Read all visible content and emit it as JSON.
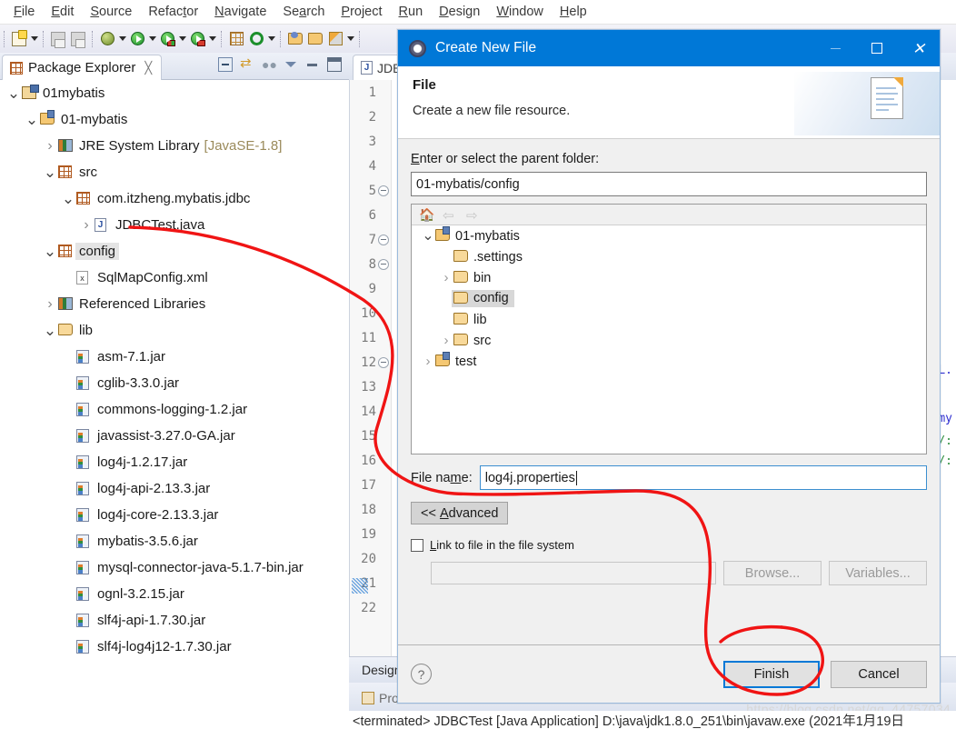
{
  "menubar": {
    "items": [
      {
        "label": "File",
        "mnemonic": "F"
      },
      {
        "label": "Edit",
        "mnemonic": "E"
      },
      {
        "label": "Source",
        "mnemonic": "S"
      },
      {
        "label": "Refactor",
        "mnemonic": "t"
      },
      {
        "label": "Navigate",
        "mnemonic": "N"
      },
      {
        "label": "Search",
        "mnemonic": "a"
      },
      {
        "label": "Project",
        "mnemonic": "P"
      },
      {
        "label": "Run",
        "mnemonic": "R"
      },
      {
        "label": "Design",
        "mnemonic": "D"
      },
      {
        "label": "Window",
        "mnemonic": "W"
      },
      {
        "label": "Help",
        "mnemonic": "H"
      }
    ]
  },
  "toolbar": {
    "icons": [
      "new-file-icon",
      "save-icon",
      "save-all-icon",
      "debug-icon",
      "run-icon",
      "run-as-icon",
      "debug-as-icon",
      "new-java-package-icon",
      "refresh-icon",
      "open-type-icon",
      "open-resource-icon",
      "edit-icon"
    ]
  },
  "package_explorer": {
    "tab_label": "Package Explorer",
    "tools": [
      "collapse-all-icon",
      "link-with-editor-icon",
      "view-menu-dots-icon",
      "filter-icon",
      "minimize-icon",
      "maximize-icon"
    ],
    "tree": [
      {
        "label": "01mybatis",
        "icon": "project-icon",
        "indent": 0,
        "twisty": "open",
        "selected": false
      },
      {
        "label": "01-mybatis",
        "icon": "java-project-icon",
        "indent": 1,
        "twisty": "open",
        "selected": false
      },
      {
        "label": "JRE System Library",
        "suffix": "[JavaSE-1.8]",
        "icon": "library-icon",
        "indent": 2,
        "twisty": "closed",
        "selected": false
      },
      {
        "label": "src",
        "icon": "source-folder-icon",
        "indent": 2,
        "twisty": "open",
        "selected": false
      },
      {
        "label": "com.itzheng.mybatis.jdbc",
        "icon": "package-icon",
        "indent": 3,
        "twisty": "open",
        "selected": false
      },
      {
        "label": "JDBCTest.java",
        "icon": "java-file-icon",
        "indent": 4,
        "twisty": "closed",
        "selected": false
      },
      {
        "label": "config",
        "icon": "source-folder-icon",
        "indent": 2,
        "twisty": "open",
        "selected": true
      },
      {
        "label": "SqlMapConfig.xml",
        "icon": "xml-file-icon",
        "indent": 3,
        "twisty": "none",
        "selected": false
      },
      {
        "label": "Referenced Libraries",
        "icon": "library-icon",
        "indent": 2,
        "twisty": "closed",
        "selected": false
      },
      {
        "label": "lib",
        "icon": "folder-icon",
        "indent": 2,
        "twisty": "open",
        "selected": false
      },
      {
        "label": "asm-7.1.jar",
        "icon": "jar-icon",
        "indent": 3,
        "twisty": "none",
        "selected": false
      },
      {
        "label": "cglib-3.3.0.jar",
        "icon": "jar-icon",
        "indent": 3,
        "twisty": "none",
        "selected": false
      },
      {
        "label": "commons-logging-1.2.jar",
        "icon": "jar-icon",
        "indent": 3,
        "twisty": "none",
        "selected": false
      },
      {
        "label": "javassist-3.27.0-GA.jar",
        "icon": "jar-icon",
        "indent": 3,
        "twisty": "none",
        "selected": false
      },
      {
        "label": "log4j-1.2.17.jar",
        "icon": "jar-icon",
        "indent": 3,
        "twisty": "none",
        "selected": false
      },
      {
        "label": "log4j-api-2.13.3.jar",
        "icon": "jar-icon",
        "indent": 3,
        "twisty": "none",
        "selected": false
      },
      {
        "label": "log4j-core-2.13.3.jar",
        "icon": "jar-icon",
        "indent": 3,
        "twisty": "none",
        "selected": false
      },
      {
        "label": "mybatis-3.5.6.jar",
        "icon": "jar-icon",
        "indent": 3,
        "twisty": "none",
        "selected": false
      },
      {
        "label": "mysql-connector-java-5.1.7-bin.jar",
        "icon": "jar-icon",
        "indent": 3,
        "twisty": "none",
        "selected": false
      },
      {
        "label": "ognl-3.2.15.jar",
        "icon": "jar-icon",
        "indent": 3,
        "twisty": "none",
        "selected": false
      },
      {
        "label": "slf4j-api-1.7.30.jar",
        "icon": "jar-icon",
        "indent": 3,
        "twisty": "none",
        "selected": false
      },
      {
        "label": "slf4j-log4j12-1.7.30.jar",
        "icon": "jar-icon",
        "indent": 3,
        "twisty": "none",
        "selected": false
      }
    ]
  },
  "editor": {
    "tab_label": "JDBC",
    "line_numbers": [
      "1",
      "2",
      "3",
      "4",
      "5",
      "6",
      "7",
      "8",
      "9",
      "10",
      "11",
      "12",
      "13",
      "14",
      "15",
      "16",
      "17",
      "18",
      "19",
      "20",
      "21",
      "22"
    ],
    "folded_lines": [
      "5",
      "7",
      "8",
      "12"
    ],
    "selected_line": "21",
    "code_peek": [
      "L.",
      "my",
      "/:",
      "/:"
    ]
  },
  "bottom_panel": {
    "design_tab": "Design",
    "problems_tab": "Prob",
    "console_text": "<terminated> JDBCTest [Java Application] D:\\java\\jdk1.8.0_251\\bin\\javaw.exe (2021年1月19日",
    "watermark": "https://blog.csdn.net/qq_44757034"
  },
  "dialog": {
    "title": "Create New File",
    "window_buttons": [
      "minimize-icon",
      "maximize-icon",
      "close-icon"
    ],
    "header_title": "File",
    "header_subtitle": "Create a new file resource.",
    "parent_folder_label": "Enter or select the parent folder:",
    "parent_folder_label_mnemonic": "E",
    "parent_folder_value": "01-mybatis/config",
    "tree_toolbar": [
      "home-icon",
      "back-icon",
      "forward-icon"
    ],
    "tree": [
      {
        "label": "01-mybatis",
        "icon": "java-project-icon",
        "indent": 0,
        "twisty": "open",
        "selected": false
      },
      {
        "label": ".settings",
        "icon": "folder-icon",
        "indent": 1,
        "twisty": "none",
        "selected": false
      },
      {
        "label": "bin",
        "icon": "folder-icon",
        "indent": 1,
        "twisty": "closed",
        "selected": false
      },
      {
        "label": "config",
        "icon": "folder-icon",
        "indent": 1,
        "twisty": "none",
        "selected": true
      },
      {
        "label": "lib",
        "icon": "folder-icon",
        "indent": 1,
        "twisty": "none",
        "selected": false
      },
      {
        "label": "src",
        "icon": "folder-icon",
        "indent": 1,
        "twisty": "closed",
        "selected": false
      },
      {
        "label": "test",
        "icon": "java-project-icon",
        "indent": 0,
        "twisty": "closed",
        "selected": false
      }
    ],
    "file_name_label": "File name:",
    "file_name_label_mnemonic": "m",
    "file_name_value": "log4j.properties",
    "advanced_button": "<< Advanced",
    "advanced_mnemonic": "A",
    "link_checkbox_label": "Link to file in the file system",
    "link_checkbox_mnemonic": "L",
    "link_path_value": "",
    "browse_button": "Browse...",
    "variables_button": "Variables...",
    "help_icon": "help-icon",
    "finish_button": "Finish",
    "cancel_button": "Cancel"
  },
  "annotation": {
    "color": "#f01414",
    "description": "hand-drawn red arrow from config folder to Finish button"
  }
}
